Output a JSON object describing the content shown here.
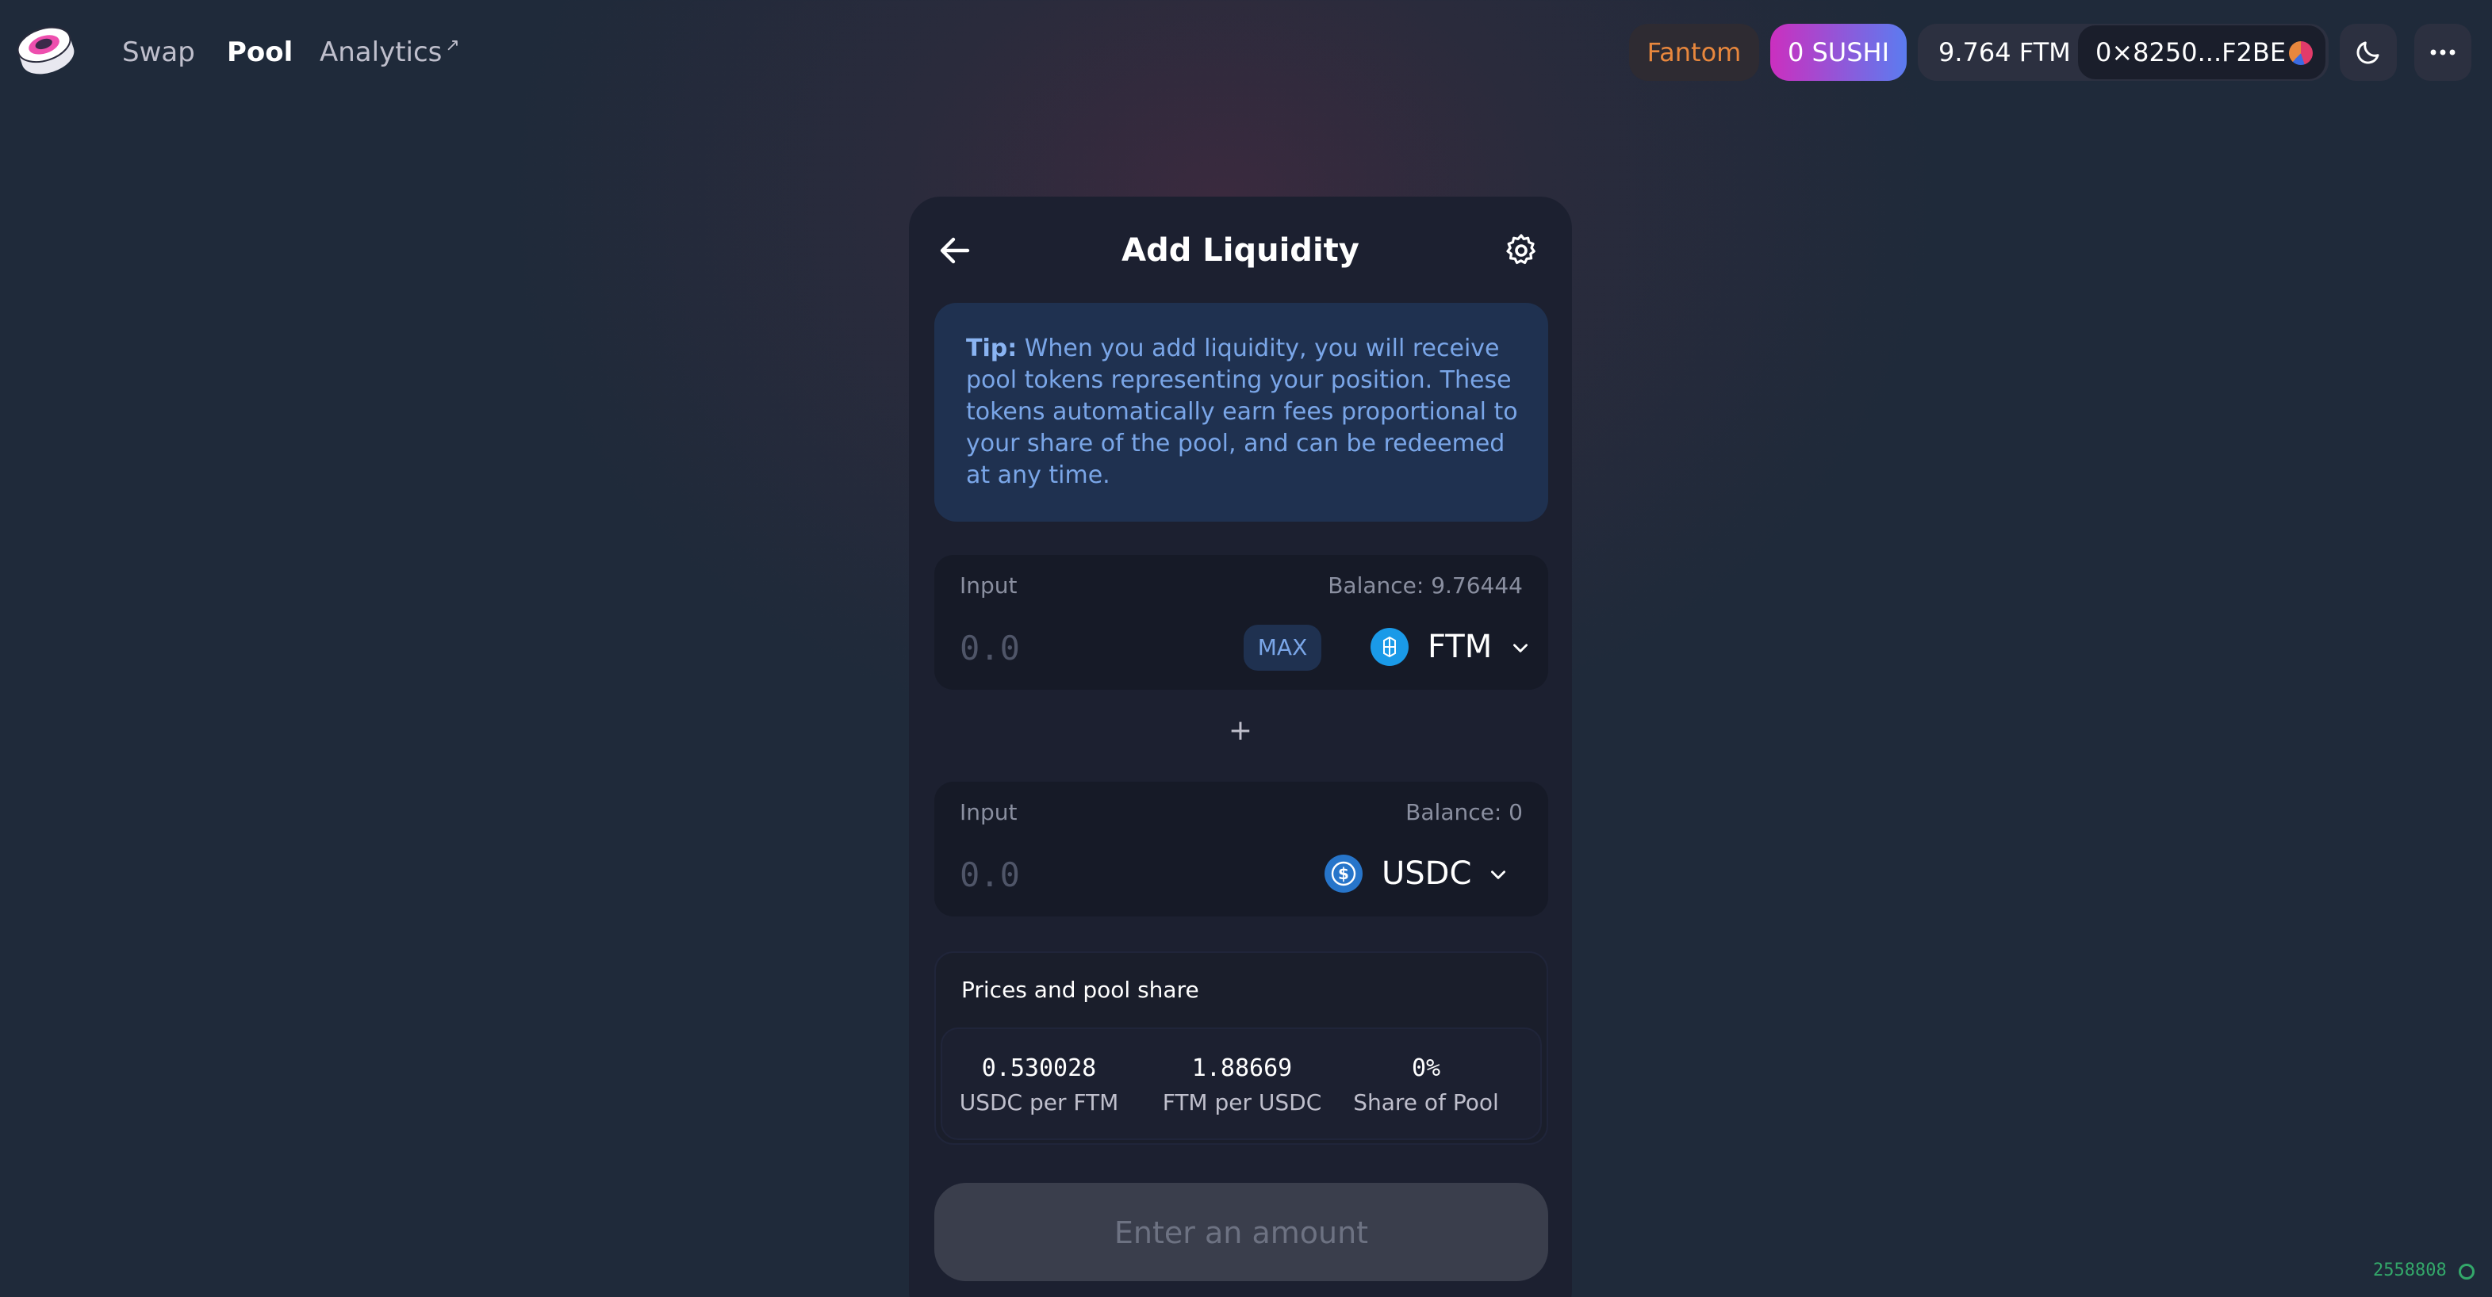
{
  "header": {
    "nav": [
      {
        "label": "Swap",
        "active": false
      },
      {
        "label": "Pool",
        "active": true
      },
      {
        "label": "Analytics",
        "active": false,
        "external_icon": "↗"
      }
    ],
    "network": "Fantom",
    "sushi_balance": "0 SUSHI",
    "native_balance": "9.764 FTM",
    "address": "0×8250...F2BE",
    "icons": {
      "logo": "sushi-logo-icon",
      "theme": "moon-icon",
      "more": "more-dots-icon"
    }
  },
  "card": {
    "title": "Add Liquidity",
    "tip_label": "Tip:",
    "tip_text": " When you add liquidity, you will receive pool tokens representing your position. These tokens automatically earn fees proportional to your share of the pool, and can be redeemed at any time.",
    "inputs": [
      {
        "label": "Input",
        "balance": "Balance: 9.76444",
        "placeholder": "0.0",
        "max_label": "MAX",
        "token": "FTM"
      },
      {
        "label": "Input",
        "balance": "Balance: 0",
        "placeholder": "0.0",
        "token": "USDC"
      }
    ],
    "plus": "+",
    "prices": {
      "title": "Prices and pool share",
      "stats": [
        {
          "value": "0.530028",
          "label": "USDC per FTM"
        },
        {
          "value": "1.88669",
          "label": "FTM per USDC"
        },
        {
          "value": "0%",
          "label": "Share of Pool"
        }
      ]
    },
    "submit_label": "Enter an amount"
  },
  "footer": {
    "block_number": "2558808"
  },
  "colors": {
    "accent": "#7aa6e8",
    "network": "#e8873d",
    "block": "#33a86a",
    "ftm": "#1a9ae8",
    "usdc": "#2775ca"
  }
}
